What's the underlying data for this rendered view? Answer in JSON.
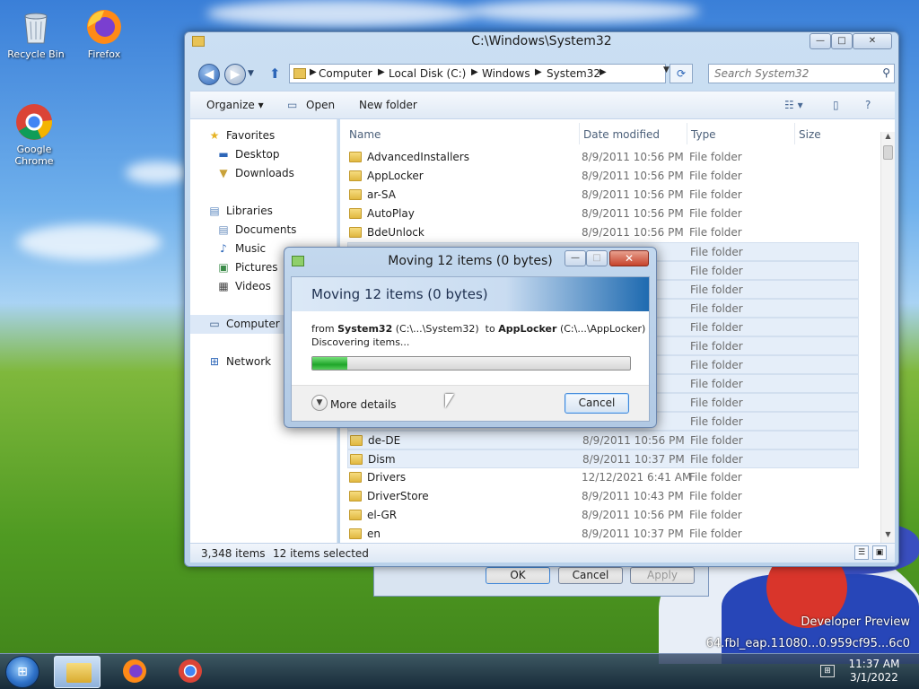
{
  "desktop": {
    "icons": [
      {
        "label": "Recycle Bin"
      },
      {
        "label": "Firefox"
      },
      {
        "label": "Google Chrome"
      }
    ],
    "watermark_line1": "Developer Preview",
    "watermark_line2": "64.fbl_eap.11080...0.959cf95...6c0"
  },
  "explorer": {
    "title": "C:\\Windows\\System32",
    "controls": {
      "minimize": "—",
      "maximize": "□",
      "close": "✕"
    },
    "breadcrumbs": [
      "Computer",
      "Local Disk (C:)",
      "Windows",
      "System32"
    ],
    "search_placeholder": "Search System32",
    "toolbar": {
      "organize": "Organize",
      "open": "Open",
      "new_folder": "New folder"
    },
    "nav": {
      "favorites": "Favorites",
      "desktop": "Desktop",
      "downloads": "Downloads",
      "libraries": "Libraries",
      "documents": "Documents",
      "music": "Music",
      "pictures": "Pictures",
      "videos": "Videos",
      "computer": "Computer",
      "network": "Network"
    },
    "columns": {
      "name": "Name",
      "date": "Date modified",
      "type": "Type",
      "size": "Size"
    },
    "rows": [
      {
        "name": "AdvancedInstallers",
        "date": "8/9/2011 10:56 PM",
        "type": "File folder",
        "selected": false
      },
      {
        "name": "AppLocker",
        "date": "8/9/2011 10:56 PM",
        "type": "File folder",
        "selected": false
      },
      {
        "name": "ar-SA",
        "date": "8/9/2011 10:56 PM",
        "type": "File folder",
        "selected": false
      },
      {
        "name": "AutoPlay",
        "date": "8/9/2011 10:56 PM",
        "type": "File folder",
        "selected": false
      },
      {
        "name": "BdeUnlock",
        "date": "8/9/2011 10:56 PM",
        "type": "File folder",
        "selected": false
      },
      {
        "name": "",
        "date": "",
        "type": "File folder",
        "selected": true
      },
      {
        "name": "",
        "date": "",
        "type": "File folder",
        "selected": true
      },
      {
        "name": "",
        "date": "",
        "type": "File folder",
        "selected": true
      },
      {
        "name": "",
        "date": "",
        "type": "File folder",
        "selected": true
      },
      {
        "name": "",
        "date": "",
        "type": "File folder",
        "selected": true
      },
      {
        "name": "",
        "date": "",
        "type": "File folder",
        "selected": true
      },
      {
        "name": "",
        "date": "",
        "type": "File folder",
        "selected": true
      },
      {
        "name": "",
        "date": "",
        "type": "File folder",
        "selected": true
      },
      {
        "name": "",
        "date": "",
        "type": "File folder",
        "selected": true
      },
      {
        "name": "",
        "date": "",
        "type": "File folder",
        "selected": true
      },
      {
        "name": "de-DE",
        "date": "8/9/2011 10:56 PM",
        "type": "File folder",
        "selected": true
      },
      {
        "name": "Dism",
        "date": "8/9/2011 10:37 PM",
        "type": "File folder",
        "selected": true
      },
      {
        "name": "Drivers",
        "date": "12/12/2021 6:41 AM",
        "type": "File folder",
        "selected": false
      },
      {
        "name": "DriverStore",
        "date": "8/9/2011 10:43 PM",
        "type": "File folder",
        "selected": false
      },
      {
        "name": "el-GR",
        "date": "8/9/2011 10:56 PM",
        "type": "File folder",
        "selected": false
      },
      {
        "name": "en",
        "date": "8/9/2011 10:37 PM",
        "type": "File folder",
        "selected": false
      }
    ],
    "status": {
      "count": "3,348 items",
      "selected": "12 items selected"
    }
  },
  "background_dialog": {
    "ok": "OK",
    "cancel": "Cancel",
    "apply": "Apply"
  },
  "move_dialog": {
    "window_title": "Moving 12 items (0 bytes)",
    "banner_title": "Moving 12 items (0 bytes)",
    "from_word": "from",
    "from_name": "System32",
    "from_path": "(C:\\...\\System32)",
    "to_word": "to",
    "to_name": "AppLocker",
    "to_path": "(C:\\...\\AppLocker)",
    "status": "Discovering items...",
    "progress_fraction": 0.11,
    "more_details": "More details",
    "cancel": "Cancel",
    "controls": {
      "minimize": "—",
      "maximize": "□",
      "close": "✕"
    }
  },
  "taskbar": {
    "clock_time": "11:37 AM",
    "clock_date": "3/1/2022"
  },
  "colors": {
    "progress": "#1fa52a",
    "selection": "#e5eef9",
    "accent": "#2d66b8"
  }
}
